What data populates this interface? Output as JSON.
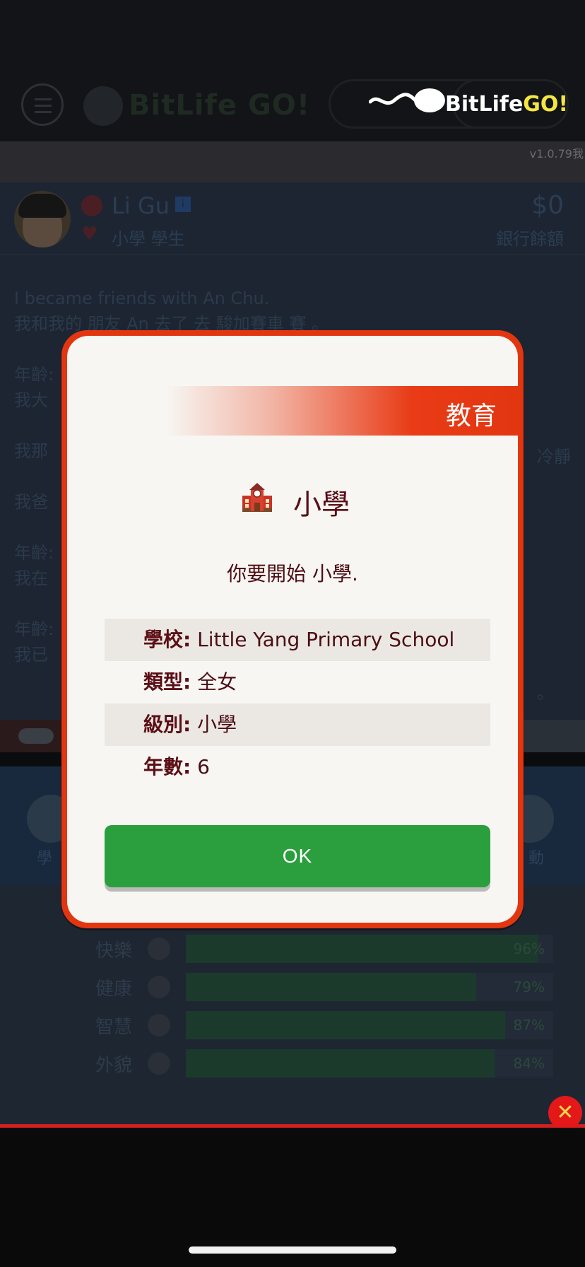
{
  "app": {
    "version": "v1.0.79我",
    "ad_banner": "BitLife GO!",
    "ad_brand_main": "BitLife",
    "ad_brand_suffix": "GO!"
  },
  "character": {
    "name": "Li Gu",
    "status": "小學 學生",
    "money": "$0",
    "money_label": "銀行餘額"
  },
  "log": [
    "I became friends with An Chu.",
    "我和我的 朋友 An 去了 去 駿加賽車 賽 。",
    "年齡:",
    "我大",
    "我那",
    "我爸",
    "年齡:",
    "我在",
    "年齡:",
    "我已"
  ],
  "log_right": [
    "冷靜",
    "。"
  ],
  "actions": [
    {
      "label": "學"
    },
    {
      "label": "動"
    }
  ],
  "stats": [
    {
      "label": "快樂",
      "icon": "smile-icon",
      "value": 0.96,
      "pct": "96%"
    },
    {
      "label": "健康",
      "icon": "heart-icon",
      "value": 0.79,
      "pct": "79%"
    },
    {
      "label": "智慧",
      "icon": "brain-icon",
      "value": 0.87,
      "pct": "87%"
    },
    {
      "label": "外貌",
      "icon": "looks-icon",
      "value": 0.84,
      "pct": "84%"
    }
  ],
  "modal": {
    "category": "教育",
    "title": "小學",
    "icon": "school-building-icon",
    "message": "你要開始 小學.",
    "rows": [
      {
        "key": "學校:",
        "value": "Little Yang Primary School"
      },
      {
        "key": "類型:",
        "value": "全女"
      },
      {
        "key": "級別:",
        "value": "小學"
      },
      {
        "key": "年數:",
        "value": "6"
      }
    ],
    "ok_label": "OK"
  },
  "colors": {
    "modal_border": "#e23611",
    "ok_button": "#2b9f3e",
    "title_text": "#5b0e16",
    "close_ad": "#e41818"
  }
}
